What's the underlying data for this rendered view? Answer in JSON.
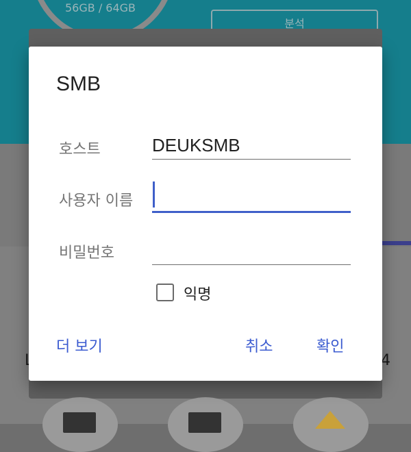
{
  "background": {
    "storage_usage": "56GB / 64GB",
    "analyze_button": "분석",
    "left_label_fragment": "L",
    "right_label_fragment": "4"
  },
  "dialog": {
    "title": "SMB",
    "fields": [
      {
        "label": "호스트",
        "value": "DEUKSMB"
      },
      {
        "label": "사용자 이름",
        "value": ""
      },
      {
        "label": "비밀번호",
        "value": ""
      }
    ],
    "anonymous_label": "익명",
    "anonymous_checked": false,
    "more_label": "더 보기",
    "cancel_label": "취소",
    "ok_label": "확인"
  },
  "colors": {
    "accent": "#3b5bd0",
    "teal_background": "#157e8c"
  }
}
